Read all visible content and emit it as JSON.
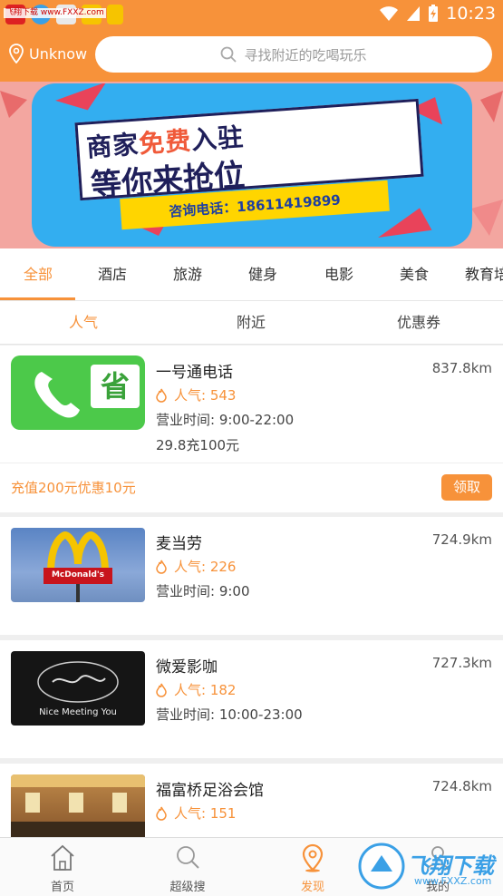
{
  "status_bar": {
    "time": "10:23",
    "watermark": "飞翔下载 www.FXXZ.com"
  },
  "header": {
    "location": "Unknow",
    "search_placeholder": "寻找附近的吃喝玩乐"
  },
  "banner": {
    "line1_a": "商家",
    "line1_b": "免费",
    "line1_c": "入驻",
    "line2": "等你来抢位",
    "phone": "咨询电话：18611419899"
  },
  "categories": [
    "全部",
    "酒店",
    "旅游",
    "健身",
    "电影",
    "美食",
    "教育培"
  ],
  "sub_tabs": [
    "人气",
    "附近",
    "优惠券"
  ],
  "listings": [
    {
      "name": "一号通电话",
      "distance": "837.8km",
      "popularity": "人气: 543",
      "hours": "营业时间: 9:00-22:00",
      "offer": "29.8充100元",
      "coupon": "充值200元优惠10元",
      "coupon_button": "领取",
      "thumb_text": "省"
    },
    {
      "name": "麦当劳",
      "distance": "724.9km",
      "popularity": "人气: 226",
      "hours": "营业时间: 9:00",
      "thumb_text": "McDonald's"
    },
    {
      "name": "微爱影咖",
      "distance": "727.3km",
      "popularity": "人气: 182",
      "hours": "营业时间: 10:00-23:00",
      "thumb_text": "Nice Meeting You"
    },
    {
      "name": "福富桥足浴会馆",
      "distance": "724.8km",
      "popularity": "人气: 151"
    }
  ],
  "bottom_nav": [
    {
      "label": "首页",
      "icon": "home-icon"
    },
    {
      "label": "超级搜",
      "icon": "search-icon"
    },
    {
      "label": "发现",
      "icon": "location-pin-icon"
    },
    {
      "label": "我的",
      "icon": "user-icon"
    }
  ],
  "watermark": {
    "brand": "飞翔下载",
    "url": "www.FXXZ.com"
  },
  "colors": {
    "accent": "#f7923a",
    "banner_bg": "#33aef0"
  }
}
